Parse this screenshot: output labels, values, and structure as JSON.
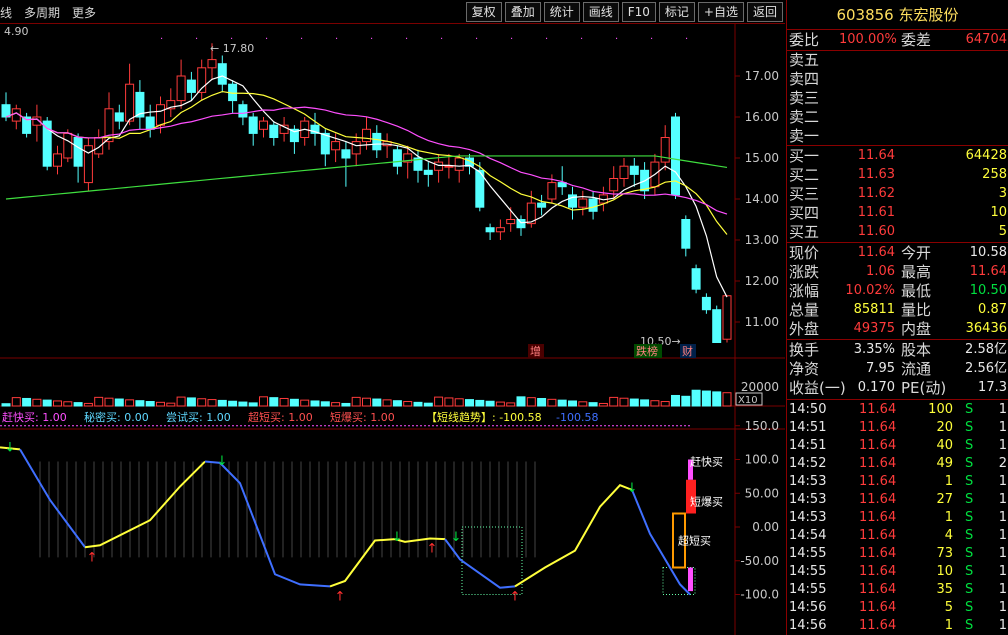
{
  "toolbar": {
    "left": [
      "线",
      "多周期",
      "更多"
    ],
    "buttons": [
      "复权",
      "叠加",
      "统计",
      "画线",
      "F10",
      "标记",
      "+自选",
      "返回"
    ]
  },
  "kline": {
    "corner_value": "4.90",
    "high_marker": "17.80",
    "low_marker": "10.50",
    "price_ticks": [
      "17.00",
      "16.00",
      "15.00",
      "14.00",
      "13.00",
      "12.00",
      "11.00"
    ],
    "tags": [
      "增",
      "跌榜",
      "财"
    ]
  },
  "volume": {
    "ticks": [
      "20000"
    ],
    "unit": "X10"
  },
  "indicator": {
    "legend": [
      {
        "text": "赶快买: 1.00",
        "color": "#ff4fff"
      },
      {
        "text": "秘密买: 0.00",
        "color": "#5fd8ff"
      },
      {
        "text": "尝试买: 1.00",
        "color": "#5fd8ff"
      },
      {
        "text": "超短买: 1.00",
        "color": "#ff5050"
      },
      {
        "text": "短爆买: 1.00",
        "color": "#ff5050"
      },
      {
        "text": "【短线趋势】: -100.58",
        "color": "#ffff3b"
      },
      {
        "text": "-100.58",
        "color": "#3f6fff"
      }
    ],
    "ticks": [
      "150.0",
      "100.0",
      "50.00",
      "0.00",
      "-50.00",
      "-100.0"
    ],
    "labels": [
      "赶快买",
      "短爆买",
      "超短买"
    ]
  },
  "stock": {
    "code": "603856",
    "name": "东宏股份"
  },
  "weibi": {
    "label": "委比",
    "value": "100.00%",
    "label2": "委差",
    "value2": "64704"
  },
  "sell": [
    {
      "label": "卖五"
    },
    {
      "label": "卖四"
    },
    {
      "label": "卖三"
    },
    {
      "label": "卖二"
    },
    {
      "label": "卖一"
    }
  ],
  "buy": [
    {
      "label": "买一",
      "price": "11.64",
      "vol": "64428"
    },
    {
      "label": "买二",
      "price": "11.63",
      "vol": "258"
    },
    {
      "label": "买三",
      "price": "11.62",
      "vol": "3"
    },
    {
      "label": "买四",
      "price": "11.61",
      "vol": "10"
    },
    {
      "label": "买五",
      "price": "11.60",
      "vol": "5"
    }
  ],
  "quote": [
    {
      "l1": "现价",
      "v1": "11.64",
      "c1": "red",
      "l2": "今开",
      "v2": "10.58",
      "c2": "wht"
    },
    {
      "l1": "涨跌",
      "v1": "1.06",
      "c1": "red",
      "l2": "最高",
      "v2": "11.64",
      "c2": "red"
    },
    {
      "l1": "涨幅",
      "v1": "10.02%",
      "c1": "red",
      "l2": "最低",
      "v2": "10.50",
      "c2": "grn"
    },
    {
      "l1": "总量",
      "v1": "85811",
      "c1": "yel",
      "l2": "量比",
      "v2": "0.87",
      "c2": "yel"
    },
    {
      "l1": "外盘",
      "v1": "49375",
      "c1": "red",
      "l2": "内盘",
      "v2": "36436",
      "c2": "yel"
    }
  ],
  "stats": [
    {
      "l1": "换手",
      "v1": "3.35%",
      "l2": "股本",
      "v2": "2.58亿"
    },
    {
      "l1": "净资",
      "v1": "7.95",
      "l2": "流通",
      "v2": "2.56亿"
    },
    {
      "l1": "收益(一)",
      "v1": "0.170",
      "l2": "PE(动)",
      "v2": "17.3"
    }
  ],
  "ticks": [
    {
      "time": "14:50",
      "price": "11.64",
      "vol": "100",
      "bs": "S",
      "n": "1"
    },
    {
      "time": "14:51",
      "price": "11.64",
      "vol": "20",
      "bs": "S",
      "n": "1"
    },
    {
      "time": "14:51",
      "price": "11.64",
      "vol": "40",
      "bs": "S",
      "n": "1"
    },
    {
      "time": "14:52",
      "price": "11.64",
      "vol": "49",
      "bs": "S",
      "n": "2"
    },
    {
      "time": "14:53",
      "price": "11.64",
      "vol": "1",
      "bs": "S",
      "n": "1"
    },
    {
      "time": "14:53",
      "price": "11.64",
      "vol": "27",
      "bs": "S",
      "n": "1"
    },
    {
      "time": "14:53",
      "price": "11.64",
      "vol": "1",
      "bs": "S",
      "n": "1"
    },
    {
      "time": "14:54",
      "price": "11.64",
      "vol": "4",
      "bs": "S",
      "n": "1"
    },
    {
      "time": "14:55",
      "price": "11.64",
      "vol": "73",
      "bs": "S",
      "n": "1"
    },
    {
      "time": "14:55",
      "price": "11.64",
      "vol": "10",
      "bs": "S",
      "n": "1"
    },
    {
      "time": "14:55",
      "price": "11.64",
      "vol": "35",
      "bs": "S",
      "n": "1"
    },
    {
      "time": "14:56",
      "price": "11.64",
      "vol": "5",
      "bs": "S",
      "n": "1"
    },
    {
      "time": "14:56",
      "price": "11.64",
      "vol": "1",
      "bs": "S",
      "n": "1"
    }
  ],
  "colors": {
    "up": "#ff3b3b",
    "down": "#54ffff",
    "ma5": "#ffffff",
    "ma10": "#ffff3b",
    "ma20": "#ff4fff",
    "ma60": "#3fdf3f",
    "grid": "#7a0000"
  }
}
